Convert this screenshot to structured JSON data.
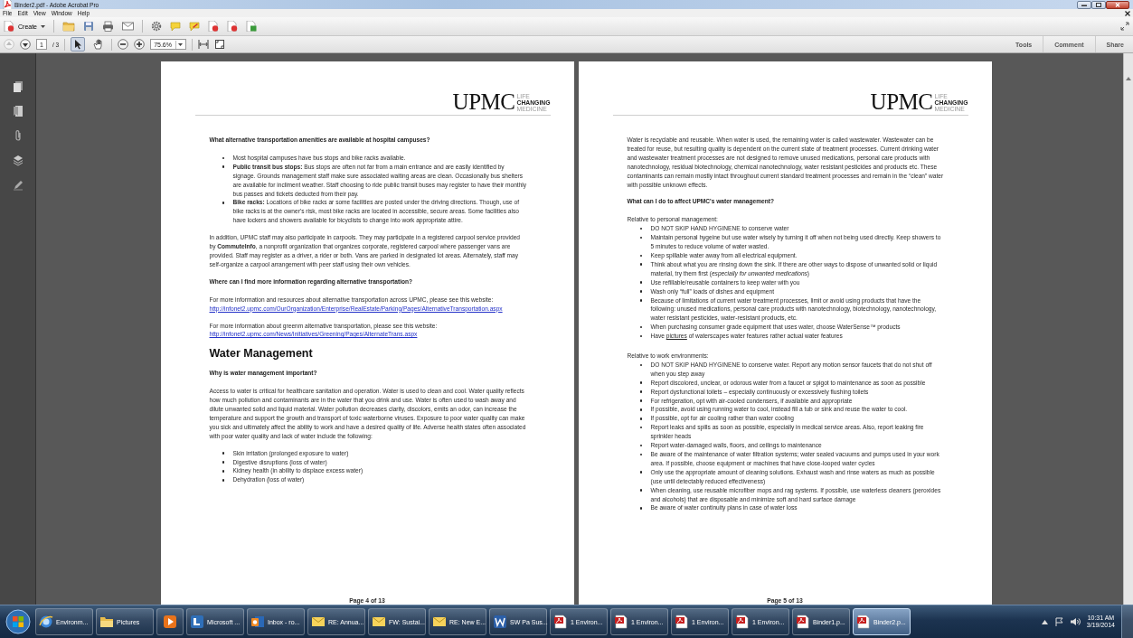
{
  "window": {
    "title": "Binder2.pdf - Adobe Acrobat Pro"
  },
  "menu": [
    "File",
    "Edit",
    "View",
    "Window",
    "Help"
  ],
  "toolbar": {
    "create": "Create"
  },
  "nav": {
    "previous": {
      "disabled": true
    },
    "next": {
      "disabled": false
    },
    "page": "1",
    "page_count": "/ 3",
    "zoom": "75.6%",
    "tools": [
      {
        "kind": "select",
        "selected": true
      },
      {
        "kind": "hand",
        "selected": false
      }
    ]
  },
  "panels": [
    "Tools",
    "Comment",
    "Share"
  ],
  "pages": [
    {
      "logo": "UPMC",
      "tagline": [
        "LIFE",
        "CHANGING",
        "MEDICINE"
      ],
      "footer": "Page 4 of 13",
      "blocks": [
        {
          "kind": "question",
          "text": "What alternative transportation amenities are available at hospital campuses?"
        },
        {
          "kind": "bullets",
          "items": [
            "Most hospital campuses have bus stops and bike racks available.",
            "**Public transit bus stops:** Bus stops are often not far from a main entrance and are easily identified by signage. Grounds management staff make sure associated waiting areas are clean. Occasionally bus shelters are available for incliment weather. Staff choosing to ride public transit buses may register to have their monthly bus passes and tickets deducted from their pay.",
            "**Bike racks:** Locations of bike racks ar some facilities are posted under the driving directions. Though, use of bike racks is at the owner's risk, most bike racks are located in accessible, secure areas. Some facilities also have lockers and showers available for bicyclists to change into work appropriate attire."
          ]
        },
        {
          "kind": "paragraph",
          "text": "In addition, UPMC staff may also participate in carpools. They may participate in a registered carpool service provided by **CommuteInfo**, a nonprofit organization that organizes corporate, registered carpool where passenger vans are provided. Staff may register as a driver, a rider or both. Vans are parked in designated lot areas. Alternately, staff may self-organize a carpool arrangement with peer staff using their own vehicles."
        },
        {
          "kind": "question",
          "text": "Where can I find more information regarding alternative transportation?"
        },
        {
          "kind": "link_paragraph",
          "text": "For more information and resources about alternative transportation across UPMC, please see this website:",
          "link": "http://infonet2.upmc.com/OurOrganization/Enterprise/RealEstate/Parking/Pages/AlternativeTransportation.aspx"
        },
        {
          "kind": "link_paragraph",
          "text": "For more information about greenm alternative transportation, please see this website:",
          "link": "http://infonet2.upmc.com/News/Initiatives/Greening/Pages/AlternateTrans.aspx"
        },
        {
          "kind": "heading",
          "text": "Water Management"
        },
        {
          "kind": "question",
          "text": "Why is water management important?"
        },
        {
          "kind": "paragraph",
          "text": "Access to water is critical for healthcare sanitation and operation. Water is used to clean and cool. Water quality reflects how much pollution and contaminants are in the water that you drink and use. Water is often used to wash away and dilute unwanted solid and liquid material. Water pollution decreases clarity, discolors, emits an odor, can increase the temperature and support the growth and transport of toxic waterborne viruses. Exposure to poor water quality can make you sick and ultimately affect the ability to work and have a desired quality of life. Adverse health states often associated with poor water quality and lack of water include the following:"
        },
        {
          "kind": "bullets",
          "items": [
            "Skin irritation (prolonged exposure to water)",
            "Digestive disruptions (loss of water)",
            "Kidney health (in ability to displace excess water)",
            "Dehydration (loss of water)"
          ]
        }
      ]
    },
    {
      "logo": "UPMC",
      "tagline": [
        "LIFE",
        "CHANGING",
        "MEDICINE"
      ],
      "footer": "Page 5 of 13",
      "blocks": [
        {
          "kind": "paragraph",
          "text": "Water is recyclable and reusable. When water is used, the remaining water is called wastewater. Wastewater can be treated for reuse, but resulting quality is dependent on the current state of treatment processes. Current drinking water and wastewater treatment processes are not designed to remove unused medications, personal care products with nanotechnology, residual biotechnology, chemical nanotechnology, water resistant pesticides and products etc. These contaminants can remain mostly intact throughout current standard treatment processes and remain in the “clean” water with possible unknown effects."
        },
        {
          "kind": "question",
          "text": "What can I do to affect UPMC's water management?"
        },
        {
          "kind": "label",
          "text": "Relative to personal management:"
        },
        {
          "kind": "bullets",
          "items": [
            "DO NOT SKIP HAND HYGINENE to conserve water",
            "Maintain personal hygeine but use water wisely by turning it off when not being used directly. Keep showers to 5 minutes to reduce volume of water wasted.",
            "Keep spillable water away from all electrical equipment.",
            "Think about what you are rinsing down the sink. If there are other ways to dispose of unwanted solid or liquid material, try them first (*especially for unwanted medications*)",
            "Use refillable/reusable containers to keep water with you",
            "Wash only “full” loads of dishes and equipment",
            "Because of limitations of current water treatment processes, limit or avoid using products that have the following: unused medications, personal care products with nanotechnology, biotechnology, nanotechnology, water resistant pesticides, water-resistant products, etc.",
            "When purchasing consumer grade equipment that uses water, choose WaterSense™ products",
            {
              "before": "Have ",
              "underlined": "pictures",
              "after": " of waterscapes water features rather actual water features"
            }
          ]
        },
        {
          "kind": "label",
          "text": "Relative to work environments:"
        },
        {
          "kind": "bullets",
          "items": [
            "DO NOT SKIP HAND HYGINENE to conserve water. Report any motion sensor faucets that do not shut off when you step away",
            "Report discolored, unclear, or odorous water from a faucet or spigot to maintenance as soon as possible",
            "Report dysfunctional toilets – especially continuously or excessively flushing toilets",
            "For refrigeration, opt with air-cooled condensers, if available and appropriate",
            "If possible, avoid using running water to cool, instead fill a tub or sink and reuse the water to cool.",
            "If possible, opt for air cooling rather than water cooling",
            "Report leaks and spills as soon as possible, especially in medical service areas. Also, report leaking fire sprinkler heads",
            "Report water-damaged walls, floors, and ceilings to maintenance",
            "Be aware of the maintenance of water filtration systems; water sealed vacuums and pumps used in your work area. If possible, choose equipment or machines that have close-looped water cycles",
            "Only use the appropriate amount of cleaning solutions. Exhaust wash and rinse waters as much as possible (use until detectably reduced effectiveness)",
            "When cleaning, use reusable microfiber mops and rag systems. If possible, use waterless cleaners (peroxides and alcohols) that are disposable and minimize soft and hard surface damage",
            "Be aware of water continuity plans in case of water loss"
          ]
        }
      ]
    }
  ],
  "taskbar": {
    "items": [
      {
        "kind": "browser",
        "label": "Environm...",
        "selected": false
      },
      {
        "kind": "folder",
        "label": "Pictures",
        "selected": false
      },
      {
        "kind": "media",
        "selected": false
      },
      {
        "kind": "office",
        "label": "Microsoft ...",
        "selected": false
      },
      {
        "kind": "outlook",
        "label": "Inbox - ro...",
        "selected": false
      },
      {
        "kind": "mail",
        "label": "RE: Annua...",
        "selected": false
      },
      {
        "kind": "mail",
        "label": "FW: Sustai...",
        "selected": false
      },
      {
        "kind": "mail",
        "label": "RE: New E...",
        "selected": false
      },
      {
        "kind": "word",
        "label": "SW Pa Sus...",
        "selected": false
      },
      {
        "kind": "pdf",
        "label": "1 Environ...",
        "selected": false
      },
      {
        "kind": "pdf",
        "label": "1 Environ...",
        "selected": false
      },
      {
        "kind": "pdf",
        "label": "1 Environ...",
        "selected": false
      },
      {
        "kind": "pdf",
        "label": "1 Environ...",
        "selected": false
      },
      {
        "kind": "pdf",
        "label": "Binder1.p...",
        "selected": false
      },
      {
        "kind": "pdf",
        "label": "Binder2.p...",
        "selected": true
      }
    ],
    "time": "10:31 AM",
    "date": "3/19/2014"
  }
}
